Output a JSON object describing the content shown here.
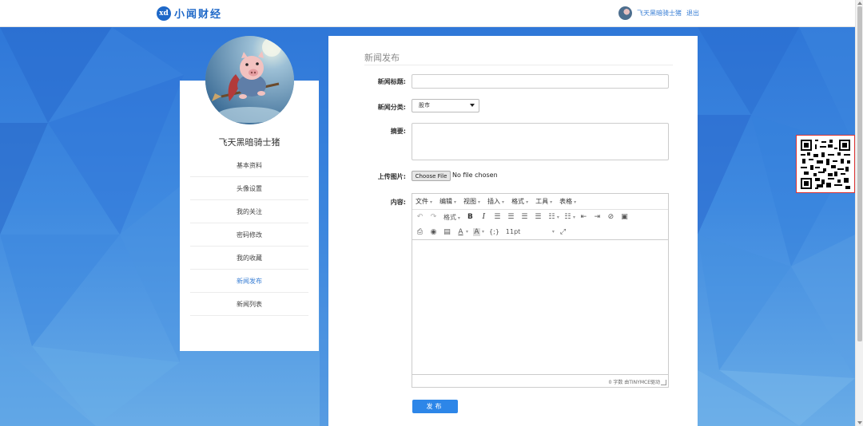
{
  "header": {
    "logo_mark": "xd",
    "logo_text": "小闻财经",
    "username": "飞天黑暗骑士猪",
    "logout_label": "退出"
  },
  "sidebar": {
    "name": "飞天黑暗骑士猪",
    "items": [
      {
        "label": "基本资料"
      },
      {
        "label": "头像设置"
      },
      {
        "label": "我的关注"
      },
      {
        "label": "密码修改"
      },
      {
        "label": "我的收藏"
      },
      {
        "label": "新闻发布",
        "active": true
      },
      {
        "label": "新闻列表"
      }
    ]
  },
  "form": {
    "title": "新闻发布",
    "title_label": "新闻标题:",
    "title_value": "",
    "category_label": "新闻分类:",
    "category_value": "股市",
    "summary_label": "摘要:",
    "summary_value": "",
    "image_label": "上传图片:",
    "file_button": "Choose File",
    "file_status": "No file chosen",
    "content_label": "内容:",
    "publish_label": "发布"
  },
  "editor": {
    "menus": [
      "文件",
      "编辑",
      "视图",
      "插入",
      "格式",
      "工具",
      "表格"
    ],
    "format_label": "格式",
    "font_size": "11pt",
    "status": "0 字数 由TINYMCE驱动"
  },
  "colors": {
    "accent": "#2d86e8",
    "link": "#3a7fd5",
    "background_top": "#2f77d8",
    "background_bottom": "#69ace7"
  }
}
